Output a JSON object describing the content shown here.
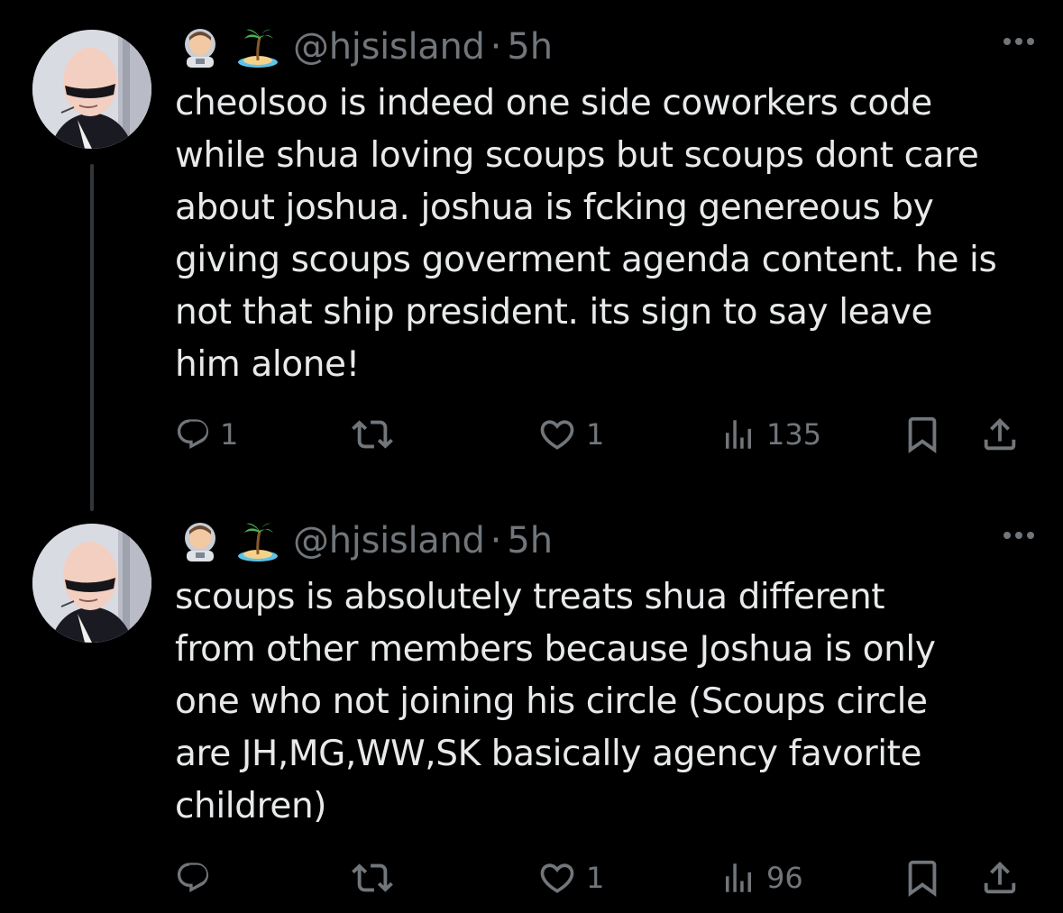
{
  "tweets": [
    {
      "handle": "@hjsisland",
      "separator": "·",
      "time": "5h",
      "text": "cheolsoo is indeed one side coworkers code\nwhile shua loving scoups but scoups dont care\nabout joshua. joshua is fcking genereous by\ngiving scoups goverment agenda content. he is\nnot that ship president. its sign to say leave\nhim alone!",
      "replies": "1",
      "retweets": "",
      "likes": "1",
      "views": "135",
      "emojis": [
        "astronaut-emoji",
        "desert-island-emoji"
      ]
    },
    {
      "handle": "@hjsisland",
      "separator": "·",
      "time": "5h",
      "text": "scoups is absolutely treats shua different\nfrom other members because Joshua is only\none who not joining his circle (Scoups circle\nare JH,MG,WW,SK basically agency favorite\nchildren)",
      "replies": "",
      "retweets": "",
      "likes": "1",
      "views": "96",
      "emojis": [
        "astronaut-emoji",
        "desert-island-emoji"
      ]
    }
  ],
  "colors": {
    "background": "#000000",
    "text": "#e7e9ea",
    "muted": "#71767b",
    "thread_line": "#333639"
  }
}
